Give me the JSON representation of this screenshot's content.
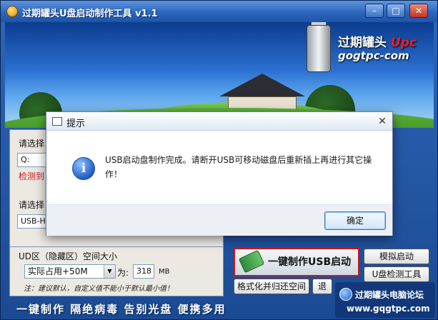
{
  "window": {
    "title": "过期罐头U盘启动制作工具 v1.1",
    "min_label": "–",
    "max_label": "□",
    "close_label": "✕"
  },
  "banner": {
    "logo_text": "过期罐头",
    "logo_upc": "Upc",
    "logo_domain": "gogtpc-com"
  },
  "form": {
    "select_label_1": "请选择",
    "drive_value": "Q:",
    "detect_text": "检测到",
    "select_label_2": "请选择",
    "usb_value": "USB-HD",
    "hidden_size_label": "UD区（隐藏区）空间大小",
    "size_mode": "实际占用+50M",
    "size_prefix": "为:",
    "size_value": "318",
    "size_unit": "MB",
    "tip": "注：建议默认，自定义值不能小于默认最小值！"
  },
  "buttons": {
    "make_usb": "一键制作USB启动盘",
    "simulate": "模拟启动",
    "usb_check": "U盘检测工具",
    "format_restore": "格式化并归还空间",
    "back": "退"
  },
  "bottom_bar": {
    "slogan": "一键制作  隔绝病毒  告别光盘  便携多用"
  },
  "watermark": {
    "forum": "过期罐头电脑论坛",
    "url": "www.gqgtpc.com"
  },
  "dialog": {
    "title": "提示",
    "close_label": "✕",
    "message": "USB启动盘制作完成。请断开USB可移动磁盘后重新插上再进行其它操作！",
    "ok_label": "确定"
  },
  "colors": {
    "accent_red": "#d0141a",
    "title_blue": "#2d66bd",
    "ok_border": "#3c7fb1"
  }
}
